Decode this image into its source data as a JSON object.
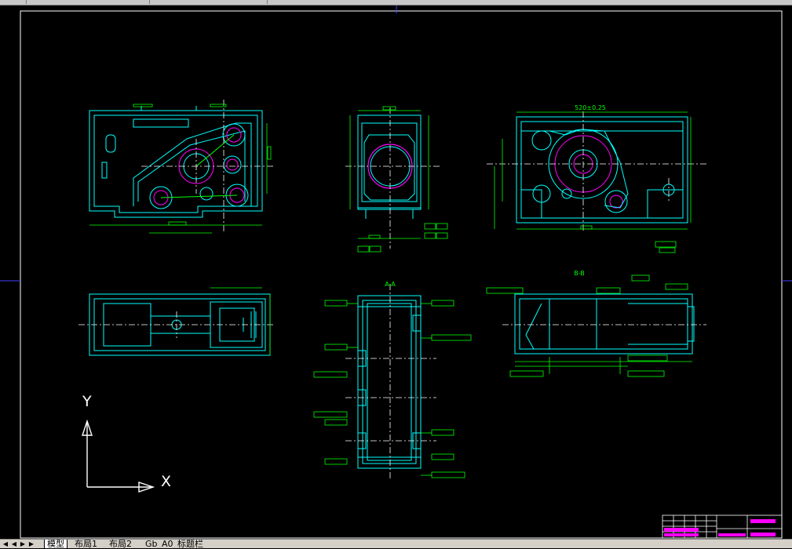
{
  "tabs": {
    "nav_first": "◀",
    "nav_prev": "◀",
    "nav_next": "▶",
    "nav_last": "▶",
    "items": [
      {
        "label": "模型",
        "active": true
      },
      {
        "label": "布局1",
        "active": false
      },
      {
        "label": "布局2",
        "active": false
      },
      {
        "label": "Gb_A0_标题栏",
        "active": false
      }
    ]
  },
  "ucs": {
    "y_label": "Y",
    "x_label": "X"
  },
  "views": {
    "top_dim": "520±0.25",
    "section_aa": "A-A",
    "section_bb": "B-B"
  },
  "colors": {
    "background": "#000000",
    "geometry": "#00ffff",
    "dimension": "#00ff00",
    "centerline": "#ffffff",
    "circle": "#ff00ff",
    "frame": "#ffffff"
  }
}
